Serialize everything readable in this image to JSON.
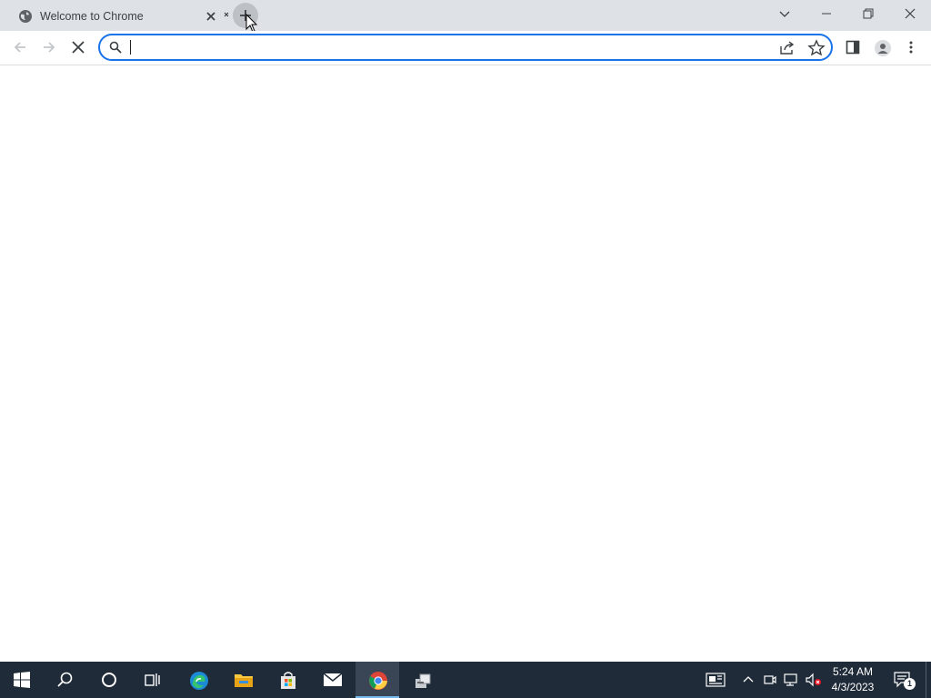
{
  "browser": {
    "tab": {
      "title": "Welcome to Chrome",
      "favicon": "globe-icon"
    },
    "new_tab_tooltip_icon": "plus-icon",
    "window_controls": [
      "tab-search",
      "minimize",
      "restore",
      "close"
    ]
  },
  "toolbar": {
    "back_icon": "arrow-left-icon",
    "forward_icon": "arrow-right-icon",
    "stop_icon": "stop-icon",
    "omnibox": {
      "value": "",
      "placeholder": ""
    },
    "share_icon": "share-icon",
    "bookmark_icon": "star-icon",
    "side_panel_icon": "side-panel-icon",
    "profile_icon": "profile-icon",
    "menu_icon": "more-vert-icon"
  },
  "taskbar": {
    "apps": [
      "start",
      "search",
      "cortana",
      "task-view",
      "edge",
      "file-explorer",
      "store",
      "mail",
      "chrome",
      "network-tool"
    ],
    "active_app": "chrome",
    "clock": {
      "time": "5:24 AM",
      "date": "4/3/2023"
    },
    "notification_count": "1"
  },
  "colors": {
    "accent": "#1a73e8",
    "tabstrip": "#dee1e6",
    "taskbar": "#1f2b38"
  }
}
